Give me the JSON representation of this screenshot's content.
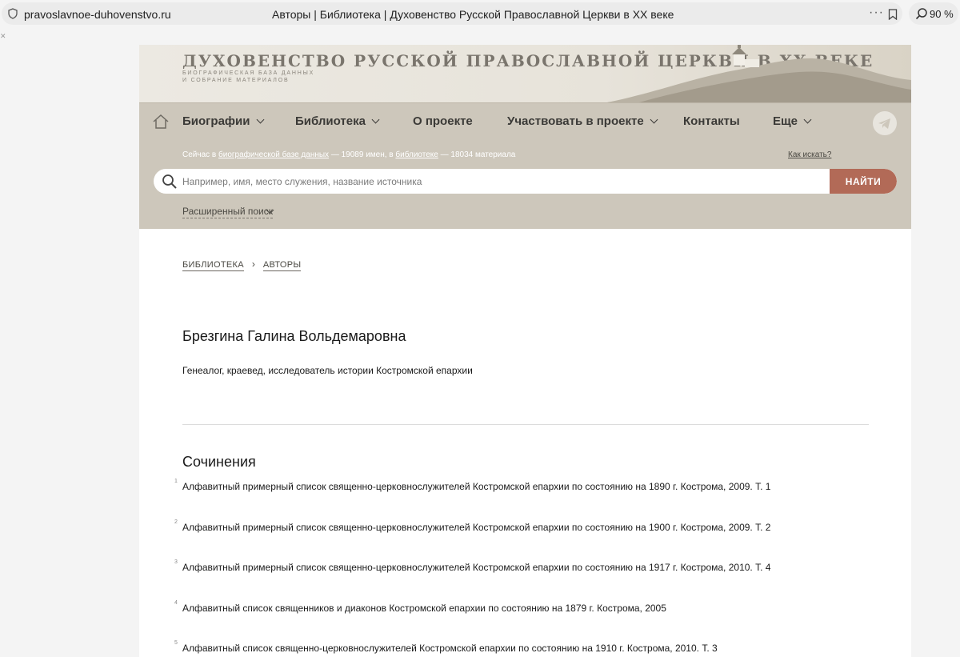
{
  "browser": {
    "url": "pravoslavnoe-duhovenstvo.ru",
    "title": "Авторы | Библиотека | Духовенство Русской Православной Церкви в XX веке",
    "zoom": "90 %"
  },
  "banner": {
    "title": "ДУХОВЕНСТВО РУССКОЙ ПРАВОСЛАВНОЙ ЦЕРКВИ В XX ВЕКЕ",
    "subtitle_line1": "БИОГРАФИЧЕСКАЯ БАЗА ДАННЫХ",
    "subtitle_line2": "И СОБРАНИЕ МАТЕРИАЛОВ"
  },
  "nav": {
    "items": [
      {
        "label": "Биографии",
        "dropdown": true
      },
      {
        "label": "Библиотека",
        "dropdown": true
      },
      {
        "label": "О проекте",
        "dropdown": false
      },
      {
        "label": "Участвовать в проекте",
        "dropdown": true
      },
      {
        "label": "Контакты",
        "dropdown": false
      },
      {
        "label": "Еще",
        "dropdown": true
      }
    ]
  },
  "search": {
    "stats_prefix": "Сейчас в",
    "stats_db_link": "биографической базе данных",
    "stats_mid": "— 19089 имен, в",
    "stats_lib_link": "библиотеке",
    "stats_suffix": "— 18034 материала",
    "howto": "Как искать?",
    "placeholder": "Например, имя, место служения, название источника",
    "button": "НАЙТИ",
    "advanced": "Расширенный поиск"
  },
  "breadcrumbs": [
    "БИБЛИОТЕКА",
    "АВТОРЫ"
  ],
  "author": {
    "name": "Брезгина Галина Вольдемаровна",
    "description": "Генеалог, краевед, исследователь истории Костромской епархии"
  },
  "works": {
    "title": "Сочинения",
    "items": [
      {
        "num": "1",
        "text": "Алфавитный примерный список священно-церковнослужителей Костромской епархии по состоянию на 1890 г. Кострома, 2009. Т. 1"
      },
      {
        "num": "2",
        "text": "Алфавитный примерный список священно-церковнослужителей Костромской епархии по состоянию на 1900 г. Кострома, 2009. Т. 2"
      },
      {
        "num": "3",
        "text": "Алфавитный примерный список священно-церковнослужителей Костромской епархии по состоянию на 1917 г. Кострома, 2010. Т. 4"
      },
      {
        "num": "4",
        "text": "Алфавитный список священников и диаконов Костромской епархии по состоянию на 1879 г. Кострома, 2005"
      },
      {
        "num": "5",
        "text": "Алфавитный список священно-церковнослужителей Костромской епархии по состоянию на 1910 г. Кострома, 2010. Т. 3"
      }
    ]
  }
}
